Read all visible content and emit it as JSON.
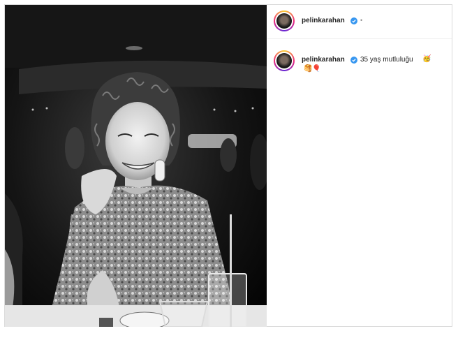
{
  "post": {
    "username": "pelinkarahan",
    "more_glyph": "•",
    "caption_text": "35 yaş mutluluğu",
    "caption_emoji_1": "🥳",
    "caption_emoji_2": "🥞",
    "caption_emoji_3": "🎈"
  },
  "colors": {
    "verified": "#3897f0",
    "text": "#262626",
    "muted": "#8e8e8e"
  },
  "icons": {
    "verified": "verified-badge-icon",
    "avatar": "avatar"
  }
}
